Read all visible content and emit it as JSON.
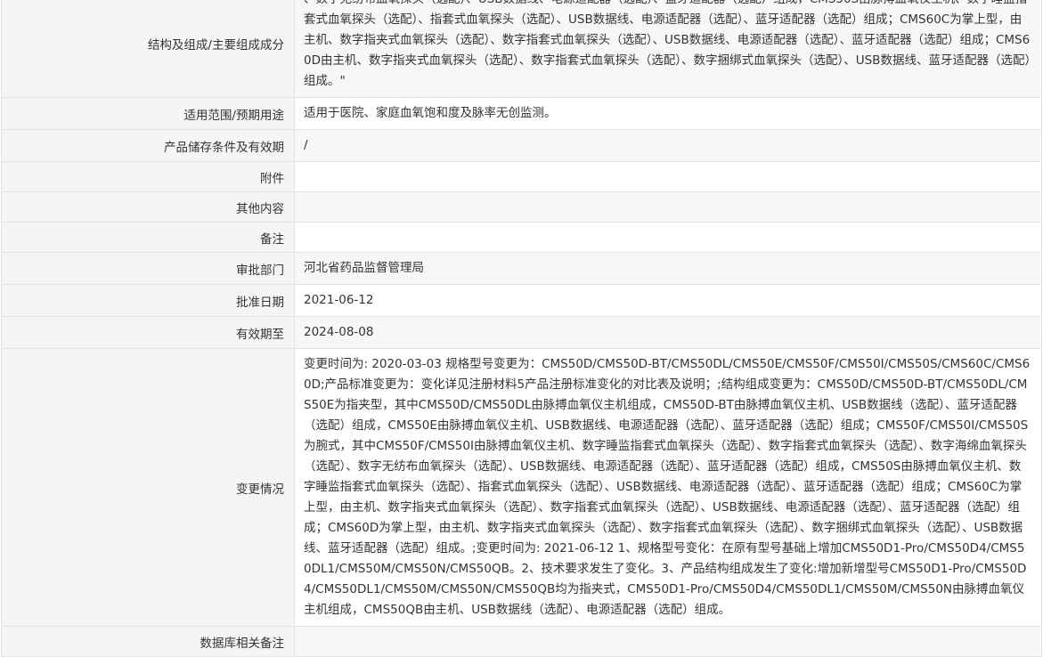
{
  "rows": [
    {
      "label": "结构及组成/主要组成成分",
      "value": "、数字无纺布血氧探头（选配）、USB数据线、电源适配器（选配）、蓝牙适配器（选配）组成，CMS50S由脉搏血氧仪主机、数字睡监指套式血氧探头（选配）、指套式血氧探头（选配）、USB数据线、电源适配器（选配）、蓝牙适配器（选配）组成；CMS60C为掌上型，由主机、数字指夹式血氧探头（选配）、数字指套式血氧探头（选配）、USB数据线、电源适配器（选配）、蓝牙适配器（选配）组成；CMS60D由主机、数字指夹式血氧探头（选配）、数字指套式血氧探头（选配）、数字捆绑式血氧探头（选配）、USB数据线、蓝牙适配器（选配）组成。\""
    },
    {
      "label": "适用范围/预期用途",
      "value": "适用于医院、家庭血氧饱和度及脉率无创监测。"
    },
    {
      "label": "产品储存条件及有效期",
      "value": "/"
    },
    {
      "label": "附件",
      "value": ""
    },
    {
      "label": "其他内容",
      "value": ""
    },
    {
      "label": "备注",
      "value": ""
    },
    {
      "label": "审批部门",
      "value": "河北省药品监督管理局"
    },
    {
      "label": "批准日期",
      "value": "2021-06-12"
    },
    {
      "label": "有效期至",
      "value": "2024-08-08"
    },
    {
      "label": "变更情况",
      "value": "变更时间为: 2020-03-03 规格型号变更为：CMS50D/CMS50D-BT/CMS50DL/CMS50E/CMS50F/CMS50I/CMS50S/CMS60C/CMS60D;产品标准变更为：变化详见注册材料5产品注册标准变化的对比表及说明；;结构组成变更为：CMS50D/CMS50D-BT/CMS50DL/CMS50E为指夹型，其中CMS50D/CMS50DL由脉搏血氧仪主机组成，CMS50D-BT由脉搏血氧仪主机、USB数据线（选配）、蓝牙适配器（选配）组成，CMS50E由脉搏血氧仪主机、USB数据线、电源适配器（选配）、蓝牙适配器（选配）组成；CMS50F/CMS50I/CMS50S为腕式，其中CMS50F/CMS50I由脉搏血氧仪主机、数字睡监指套式血氧探头（选配）、数字指套式血氧探头（选配）、数字海绵血氧探头（选配）、数字无纺布血氧探头（选配）、USB数据线、电源适配器（选配）、蓝牙适配器（选配）组成，CMS50S由脉搏血氧仪主机、数字睡监指套式血氧探头（选配）、指套式血氧探头（选配）、USB数据线、电源适配器（选配）、蓝牙适配器（选配）组成；CMS60C为掌上型，由主机、数字指夹式血氧探头（选配）、数字指套式血氧探头（选配）、USB数据线、电源适配器（选配）、蓝牙适配器（选配）组成；CMS60D为掌上型，由主机、数字指夹式血氧探头（选配）、数字指套式血氧探头（选配）、数字捆绑式血氧探头（选配）、USB数据线、蓝牙适配器（选配）组成。;变更时间为: 2021-06-12 1、规格型号变化：在原有型号基础上增加CMS50D1-Pro/CMS50D4/CMS50DL1/CMS50M/CMS50N/CMS50QB。2、技术要求发生了变化。3、产品结构组成发生了变化:增加新增型号CMS50D1-Pro/CMS50D4/CMS50DL1/CMS50M/CMS50N/CMS50QB均为指夹式，CMS50D1-Pro/CMS50D4/CMS50DL1/CMS50M/CMS50N由脉搏血氧仪主机组成，CMS50QB由主机、USB数据线（选配）、电源适配器（选配）组成。"
    },
    {
      "label": "数据库相关备注",
      "value": ""
    }
  ]
}
